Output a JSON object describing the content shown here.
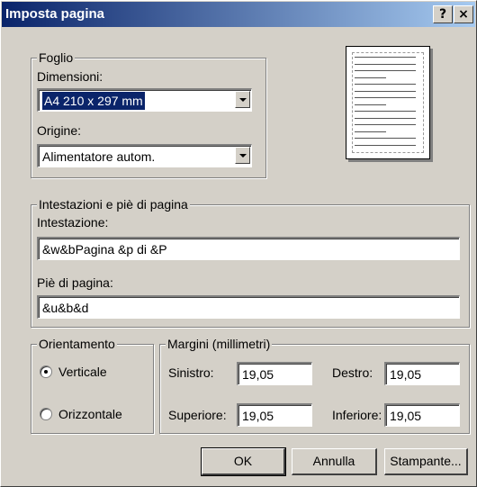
{
  "window": {
    "title": "Imposta pagina",
    "help_label": "?",
    "close_label": "×"
  },
  "foglio": {
    "legend": "Foglio",
    "dimensioni_label": "Dimensioni:",
    "dimensioni_value": "A4 210 x 297 mm",
    "origine_label": "Origine:",
    "origine_value": "Alimentatore autom."
  },
  "preview": {
    "icon": "page-preview"
  },
  "header_footer": {
    "legend": "Intestazioni e piè di pagina",
    "intestazione_label": "Intestazione:",
    "intestazione_value": "&w&bPagina &p di &P",
    "pie_label": "Piè di pagina:",
    "pie_value": "&u&b&d"
  },
  "orientamento": {
    "legend": "Orientamento",
    "verticale_label": "Verticale",
    "orizzontale_label": "Orizzontale",
    "selected": "Verticale"
  },
  "margini": {
    "legend": "Margini (millimetri)",
    "sinistro_label": "Sinistro:",
    "sinistro_value": "19,05",
    "destro_label": "Destro:",
    "destro_value": "19,05",
    "superiore_label": "Superiore:",
    "superiore_value": "19,05",
    "inferiore_label": "Inferiore:",
    "inferiore_value": "19,05"
  },
  "buttons": {
    "ok": "OK",
    "annulla": "Annulla",
    "stampante": "Stampante..."
  }
}
